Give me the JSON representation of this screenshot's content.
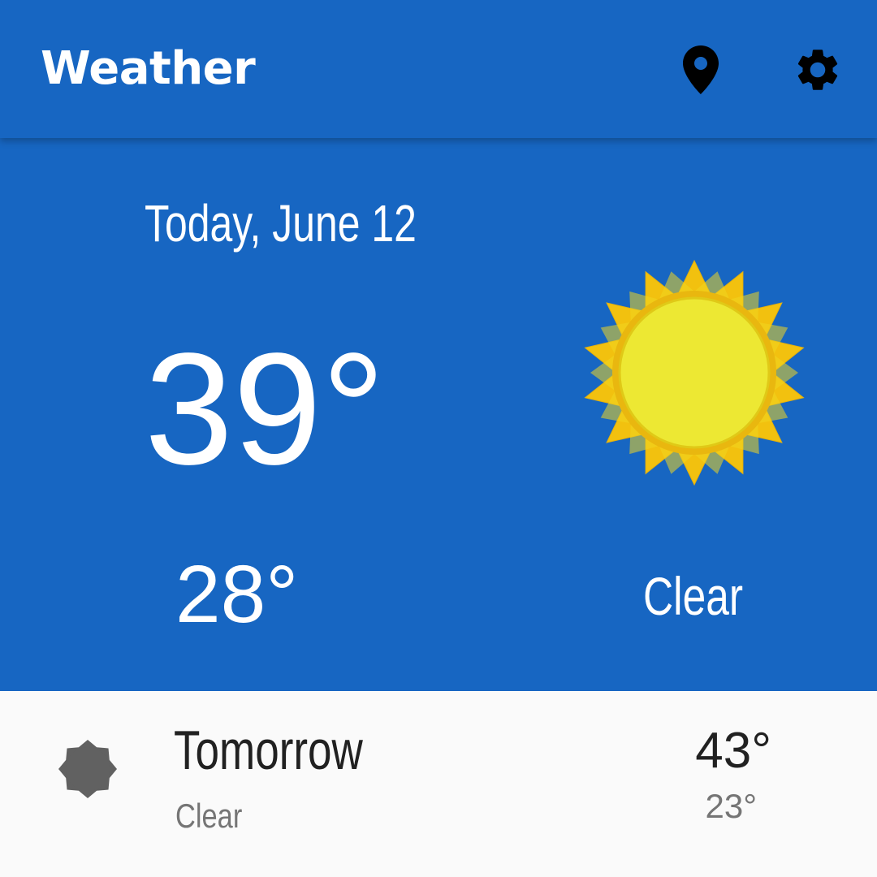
{
  "toolbar": {
    "title": "Weather",
    "location_icon": "location-pin-icon",
    "settings_icon": "gear-icon"
  },
  "today": {
    "date": "Today, June 12",
    "high": "39°",
    "low": "28°",
    "description": "Clear",
    "icon": "sun-icon"
  },
  "forecast": [
    {
      "day": "Tomorrow",
      "description": "Clear",
      "high": "43°",
      "low": "23°",
      "icon": "sun-icon"
    }
  ],
  "colors": {
    "primary": "#1766c2",
    "background": "#fafafa",
    "text_primary": "#212121",
    "text_secondary": "#757575",
    "sun_outer": "#f2c10f",
    "sun_inner": "#ede833",
    "icon_dark": "#000000",
    "row_icon": "#616161"
  }
}
